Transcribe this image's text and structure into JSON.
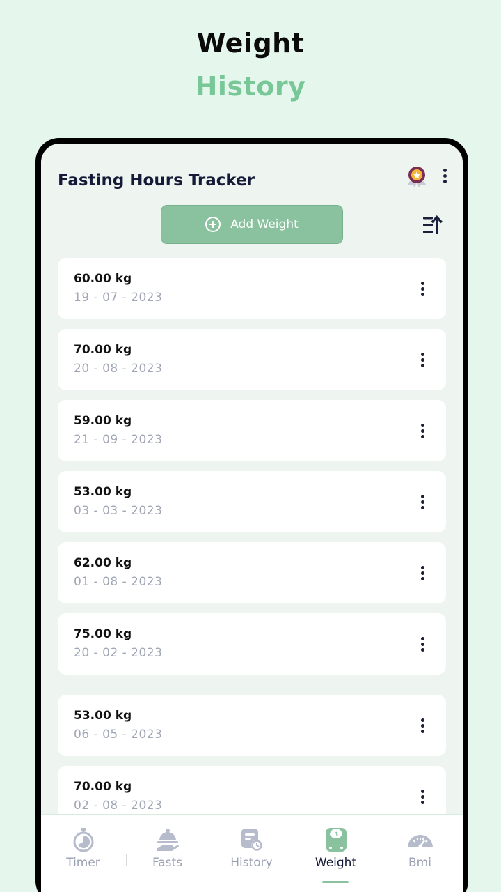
{
  "promo": {
    "title_line1": "Weight",
    "title_line2": "History"
  },
  "app": {
    "title": "Fasting Hours Tracker",
    "add_button_label": "Add Weight",
    "icons": {
      "badge": "premium-badge-icon",
      "menu": "more-vertical-icon",
      "sort": "sort-ascending-icon",
      "add": "plus-circle-icon"
    }
  },
  "entries": [
    {
      "weight": "60.00 kg",
      "date": "19 - 07 - 2023"
    },
    {
      "weight": "70.00 kg",
      "date": "20 - 08 - 2023"
    },
    {
      "weight": "59.00 kg",
      "date": "21 - 09 - 2023"
    },
    {
      "weight": "53.00 kg",
      "date": "03 - 03 - 2023"
    },
    {
      "weight": "62.00 kg",
      "date": "01 - 08 - 2023"
    },
    {
      "weight": "75.00 kg",
      "date": "20 - 02 - 2023"
    },
    {
      "weight": "53.00 kg",
      "date": "06 - 05 - 2023"
    },
    {
      "weight": "70.00 kg",
      "date": "02 - 08 - 2023"
    }
  ],
  "nav": {
    "items": [
      {
        "label": "Timer",
        "icon": "stopwatch-icon"
      },
      {
        "label": "Fasts",
        "icon": "food-tray-icon"
      },
      {
        "label": "History",
        "icon": "calendar-clock-icon"
      },
      {
        "label": "Weight",
        "icon": "weight-scale-icon"
      },
      {
        "label": "Bmi",
        "icon": "gauge-icon"
      }
    ],
    "active": "Weight"
  },
  "colors": {
    "accent": "#8ac29f",
    "promo_green": "#78c796",
    "background": "#e5f6ed",
    "text_dark": "#161a38",
    "text_muted": "#a1a6b6"
  }
}
